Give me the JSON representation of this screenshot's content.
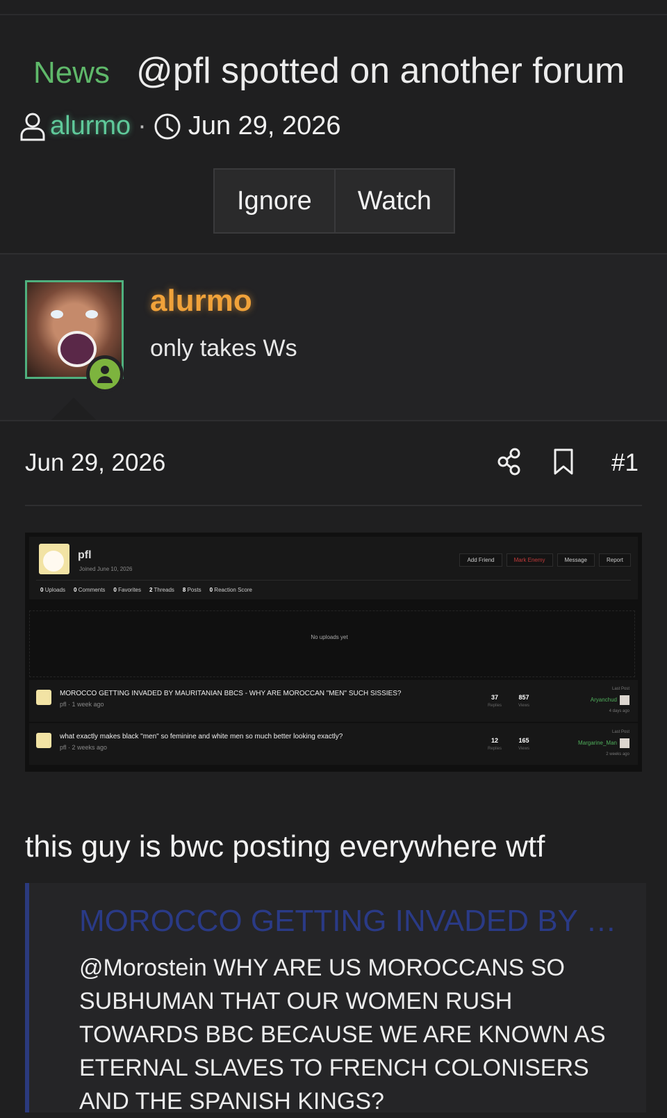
{
  "thread": {
    "prefix": "News",
    "title": "@pfl spotted on another forum",
    "author": "alurmo",
    "separator": "·",
    "date": "Jun 29, 2026"
  },
  "actions": {
    "ignore": "Ignore",
    "watch": "Watch"
  },
  "post": {
    "username": "alurmo",
    "user_title": "only takes Ws",
    "date": "Jun 29, 2026",
    "post_number": "#1",
    "message": "this guy is bwc posting everywhere wtf",
    "quote_title": "MOROCCO GETTING INVADED BY MAURITANIAN BBCS - WHY ARE MOROCCAN \"MEN\" SUCH SISSIES?",
    "quote_body": "@Morostein WHY ARE US MOROCCANS SO SUBHUMAN THAT OUR WOMEN RUSH TOWARDS BBC BECAUSE WE ARE KNOWN AS ETERNAL SLAVES TO FRENCH COLONISERS AND THE SPANISH KINGS?"
  },
  "embedded": {
    "profile_name": "pfl",
    "joined": "Joined June 10, 2026",
    "buttons": [
      "Add Friend",
      "Mark Enemy",
      "Message",
      "Report"
    ],
    "stats": [
      {
        "value": "0",
        "label": "Uploads"
      },
      {
        "value": "0",
        "label": "Comments"
      },
      {
        "value": "0",
        "label": "Favorites"
      },
      {
        "value": "2",
        "label": "Threads"
      },
      {
        "value": "8",
        "label": "Posts"
      },
      {
        "value": "0",
        "label": "Reaction Score"
      }
    ],
    "no_uploads": "No uploads yet",
    "threads": [
      {
        "title": "MOROCCO GETTING INVADED BY MAURITANIAN BBCS - WHY ARE MOROCCAN \"MEN\" SUCH SISSIES?",
        "sub": "pfl · 1 week ago",
        "replies": "37",
        "views": "857",
        "last_post_label": "Last Post",
        "last_user": "Aryanchud",
        "last_time": "4 days ago"
      },
      {
        "title": "what exactly makes black \"men\" so feminine and white men so much better looking exactly?",
        "sub": "pfl · 2 weeks ago",
        "replies": "12",
        "views": "165",
        "last_post_label": "Last Post",
        "last_user": "Margarine_Man",
        "last_time": "2 weeks ago"
      }
    ],
    "replies_label": "Replies",
    "views_label": "Views"
  },
  "colors": {
    "background": "#1f1f20",
    "prefix_green": "#5fb86a",
    "username_orange": "#f0a23a",
    "online_green": "#7db43e",
    "quote_blue": "#2a3a86"
  },
  "icons": [
    "user-icon",
    "clock-icon",
    "share-icon",
    "bookmark-icon",
    "online-status-icon"
  ]
}
